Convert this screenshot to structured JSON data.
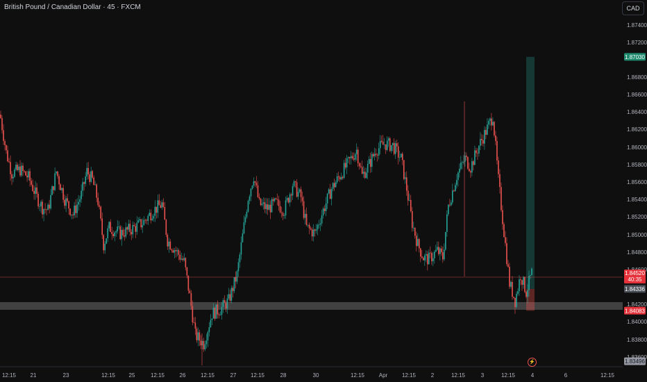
{
  "header": {
    "title": "British Pound / Canadian Dollar · 45 · FXCM",
    "currency_button": "CAD"
  },
  "colors": {
    "background": "#0f0f0f",
    "up": "#26a69a",
    "down": "#ef5350",
    "zone": "#4a4a4a",
    "price_line": "#ef5350"
  },
  "chart_data": {
    "type": "candlestick",
    "title": "British Pound / Canadian Dollar · 45 · FXCM",
    "y_axis": {
      "ylim": [
        1.8344,
        1.8764
      ],
      "tick_labels": [
        "1.87400",
        "1.87200",
        "1.86800",
        "1.86600",
        "1.86400",
        "1.86200",
        "1.86000",
        "1.85800",
        "1.85600",
        "1.85400",
        "1.85200",
        "1.85000",
        "1.84800",
        "1.84600",
        "1.84200",
        "1.84000",
        "1.83800",
        "1.83600"
      ]
    },
    "x_axis": {
      "tick_labels": [
        "12:15",
        "21",
        "23",
        "12:15",
        "25",
        "12:15",
        "26",
        "12:15",
        "27",
        "12:15",
        "28",
        "30",
        "12:15",
        "Apr",
        "12:15",
        "2",
        "12:15",
        "3",
        "12:15",
        "4",
        "6",
        "12:15"
      ]
    },
    "price_tags": [
      {
        "label": "1.87030",
        "value": 1.8703,
        "kind": "target"
      },
      {
        "label": "1.84520",
        "value": 1.8452,
        "sublabel": "40:35",
        "kind": "current"
      },
      {
        "label": "1.84336",
        "value": 1.84336,
        "kind": "entry"
      },
      {
        "label": "1.84083",
        "value": 1.84083,
        "kind": "stop"
      },
      {
        "label": "1.83496",
        "value": 1.83496,
        "kind": "low"
      }
    ],
    "zone": {
      "from": 1.841,
      "to": 1.8419
    },
    "current_price": 1.8452,
    "position": {
      "entry": 1.84336,
      "target": 1.8703,
      "stop": 1.84083
    },
    "series": [
      {
        "name": "GBPCAD",
        "anchor_points": [
          {
            "i": 0,
            "close": 1.8632
          },
          {
            "i": 4,
            "close": 1.8592
          },
          {
            "i": 8,
            "close": 1.8568
          },
          {
            "i": 14,
            "close": 1.8572
          },
          {
            "i": 20,
            "close": 1.8563
          },
          {
            "i": 26,
            "close": 1.854
          },
          {
            "i": 30,
            "close": 1.8528
          },
          {
            "i": 34,
            "close": 1.8525
          },
          {
            "i": 40,
            "close": 1.857
          },
          {
            "i": 46,
            "close": 1.8538
          },
          {
            "i": 52,
            "close": 1.852
          },
          {
            "i": 58,
            "close": 1.8543
          },
          {
            "i": 62,
            "close": 1.857
          },
          {
            "i": 66,
            "close": 1.856
          },
          {
            "i": 70,
            "close": 1.8535
          },
          {
            "i": 74,
            "close": 1.8485
          },
          {
            "i": 78,
            "close": 1.8505
          },
          {
            "i": 86,
            "close": 1.8498
          },
          {
            "i": 94,
            "close": 1.8503
          },
          {
            "i": 102,
            "close": 1.851
          },
          {
            "i": 110,
            "close": 1.8525
          },
          {
            "i": 116,
            "close": 1.8532
          },
          {
            "i": 120,
            "close": 1.849
          },
          {
            "i": 126,
            "close": 1.8478
          },
          {
            "i": 132,
            "close": 1.8465
          },
          {
            "i": 136,
            "close": 1.8425
          },
          {
            "i": 140,
            "close": 1.838
          },
          {
            "i": 146,
            "close": 1.837
          },
          {
            "i": 152,
            "close": 1.8405
          },
          {
            "i": 158,
            "close": 1.841
          },
          {
            "i": 164,
            "close": 1.842
          },
          {
            "i": 170,
            "close": 1.845
          },
          {
            "i": 174,
            "close": 1.8495
          },
          {
            "i": 178,
            "close": 1.854
          },
          {
            "i": 182,
            "close": 1.8565
          },
          {
            "i": 186,
            "close": 1.8532
          },
          {
            "i": 192,
            "close": 1.8527
          },
          {
            "i": 198,
            "close": 1.8533
          },
          {
            "i": 204,
            "close": 1.8525
          },
          {
            "i": 210,
            "close": 1.8555
          },
          {
            "i": 216,
            "close": 1.854
          },
          {
            "i": 220,
            "close": 1.8505
          },
          {
            "i": 226,
            "close": 1.8498
          },
          {
            "i": 232,
            "close": 1.8525
          },
          {
            "i": 238,
            "close": 1.855
          },
          {
            "i": 244,
            "close": 1.8565
          },
          {
            "i": 250,
            "close": 1.858
          },
          {
            "i": 256,
            "close": 1.8595
          },
          {
            "i": 260,
            "close": 1.8565
          },
          {
            "i": 264,
            "close": 1.8575
          },
          {
            "i": 270,
            "close": 1.8595
          },
          {
            "i": 276,
            "close": 1.8602
          },
          {
            "i": 282,
            "close": 1.86
          },
          {
            "i": 288,
            "close": 1.8585
          },
          {
            "i": 292,
            "close": 1.855
          },
          {
            "i": 296,
            "close": 1.851
          },
          {
            "i": 300,
            "close": 1.8485
          },
          {
            "i": 304,
            "close": 1.847
          },
          {
            "i": 308,
            "close": 1.8468
          },
          {
            "i": 314,
            "close": 1.8478
          },
          {
            "i": 318,
            "close": 1.847
          },
          {
            "i": 322,
            "close": 1.853
          },
          {
            "i": 328,
            "close": 1.8565
          },
          {
            "i": 334,
            "close": 1.8585
          },
          {
            "i": 338,
            "close": 1.8575
          },
          {
            "i": 344,
            "close": 1.86
          },
          {
            "i": 350,
            "close": 1.862
          },
          {
            "i": 354,
            "close": 1.8635
          },
          {
            "i": 358,
            "close": 1.856
          },
          {
            "i": 362,
            "close": 1.85
          },
          {
            "i": 366,
            "close": 1.844
          },
          {
            "i": 370,
            "close": 1.842
          },
          {
            "i": 374,
            "close": 1.845
          },
          {
            "i": 378,
            "close": 1.843
          },
          {
            "i": 382,
            "close": 1.8452
          }
        ]
      }
    ]
  }
}
